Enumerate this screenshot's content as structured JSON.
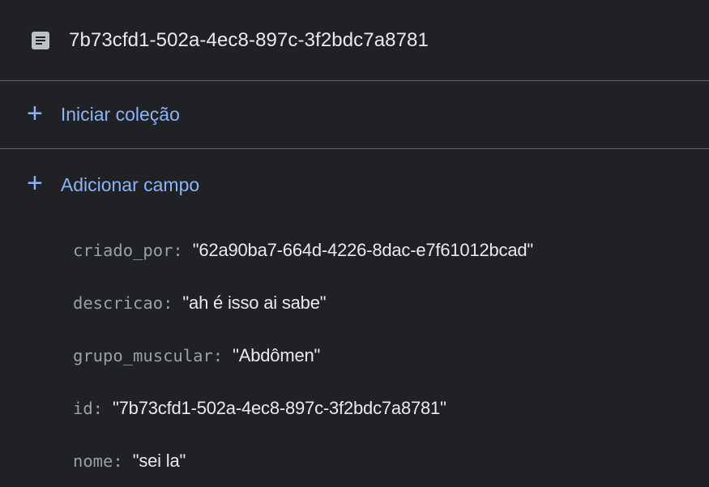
{
  "document": {
    "title": "7b73cfd1-502a-4ec8-897c-3f2bdc7a8781",
    "icon": "document-icon"
  },
  "actions": {
    "start_collection": "Iniciar coleção",
    "add_field": "Adicionar campo",
    "plus_icon": "+"
  },
  "fields": [
    {
      "key": "criado_por:",
      "value": "\"62a90ba7-664d-4226-8dac-e7f61012bcad\""
    },
    {
      "key": "descricao:",
      "value": "\"ah é isso ai sabe\""
    },
    {
      "key": "grupo_muscular:",
      "value": "\"Abdômen\""
    },
    {
      "key": "id:",
      "value": "\"7b73cfd1-502a-4ec8-897c-3f2bdc7a8781\""
    },
    {
      "key": "nome:",
      "value": "\"sei la\""
    }
  ],
  "colors": {
    "background": "#202124",
    "divider": "#5f6368",
    "accent": "#8ab4f8",
    "key_text": "#9aa0a6",
    "value_text": "#e8eaed"
  }
}
